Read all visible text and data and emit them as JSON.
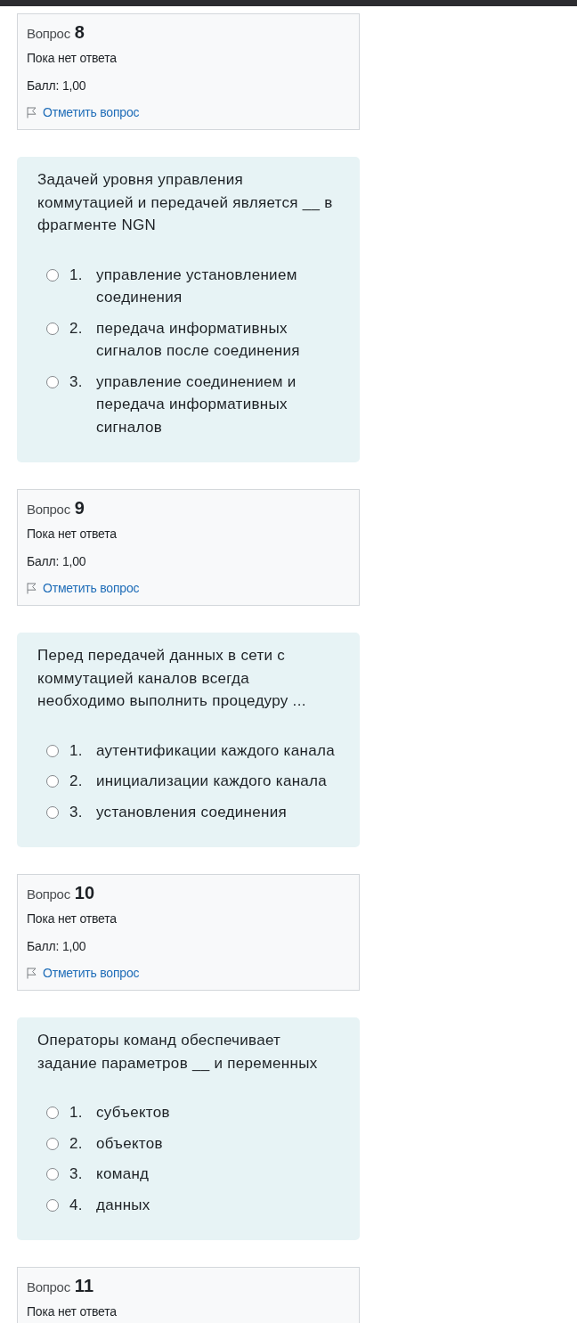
{
  "questions": [
    {
      "label": "Вопрос",
      "number": "8",
      "status": "Пока нет ответа",
      "grade": "Балл: 1,00",
      "flag_link": "Отметить вопрос",
      "text": "Задачей уровня управления коммутацией и передачей является __ в фрагменте NGN",
      "options": [
        {
          "number": "1.",
          "text": "управление установлением соединения",
          "selected": false
        },
        {
          "number": "2.",
          "text": "передача информативных сигналов после соединения",
          "selected": false
        },
        {
          "number": "3.",
          "text": "управление соединением и передача информативных сигналов",
          "selected": false
        }
      ]
    },
    {
      "label": "Вопрос",
      "number": "9",
      "status": "Пока нет ответа",
      "grade": "Балл: 1,00",
      "flag_link": "Отметить вопрос",
      "text": "Перед передачей данных в сети с коммутацией каналов всегда необходимо выполнить процедуру ...",
      "options": [
        {
          "number": "1.",
          "text": "аутентификации каждого канала",
          "selected": false
        },
        {
          "number": "2.",
          "text": "инициализации каждого канала",
          "selected": false
        },
        {
          "number": "3.",
          "text": "установления соединения",
          "selected": false
        }
      ]
    },
    {
      "label": "Вопрос",
      "number": "10",
      "status": "Пока нет ответа",
      "grade": "Балл: 1,00",
      "flag_link": "Отметить вопрос",
      "text": "Операторы команд обеспечивает задание параметров __ и переменных",
      "options": [
        {
          "number": "1.",
          "text": "субъектов",
          "selected": false
        },
        {
          "number": "2.",
          "text": "объектов",
          "selected": false
        },
        {
          "number": "3.",
          "text": "команд",
          "selected": false
        },
        {
          "number": "4.",
          "text": "данных",
          "selected": false
        }
      ]
    },
    {
      "label": "Вопрос",
      "number": "11",
      "status": "Пока нет ответа"
    }
  ]
}
